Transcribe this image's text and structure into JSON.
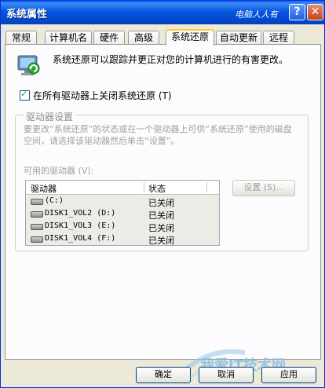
{
  "window": {
    "title": "系统属性",
    "watermark_top": "电脑人人有",
    "help_glyph": "?",
    "close_glyph": "✕"
  },
  "tabs": [
    {
      "label": "常规"
    },
    {
      "label": "计算机名"
    },
    {
      "label": "硬件"
    },
    {
      "label": "高级"
    },
    {
      "label": "系统还原",
      "active": true
    },
    {
      "label": "自动更新"
    },
    {
      "label": "远程"
    }
  ],
  "panel": {
    "description": "系统还原可以跟踪并更正对您的计算机进行的有害更改。",
    "disable_checkbox": {
      "label": "在所有驱动器上关闭系统还原 (T)",
      "checked": true
    },
    "group": {
      "label": "驱动器设置",
      "description": "要更改“系统还原”的状态或在一个驱动器上可供“系统还原”使用的磁盘空间，请选择该驱动器然后单击“设置”。",
      "available_label": "可用的驱动器 (V):",
      "columns": [
        "驱动器",
        "状态"
      ],
      "drives": [
        {
          "name": "(C:)",
          "status": "已关闭"
        },
        {
          "name": "DISK1_VOL2 (D:)",
          "status": "已关闭"
        },
        {
          "name": "DISK1_VOL3 (E:)",
          "status": "已关闭"
        },
        {
          "name": "DISK1_VOL4 (F:)",
          "status": "已关闭"
        }
      ],
      "settings_button": "设置 (S)..."
    }
  },
  "footer": {
    "ok": "确定",
    "cancel": "取消",
    "apply": "应用"
  },
  "watermark_bottom": "我爱IT技术网",
  "colors": {
    "titlebar": "#0756DF",
    "tab_active_accent": "#FFC83C",
    "window_bg": "#ECE9D8"
  }
}
